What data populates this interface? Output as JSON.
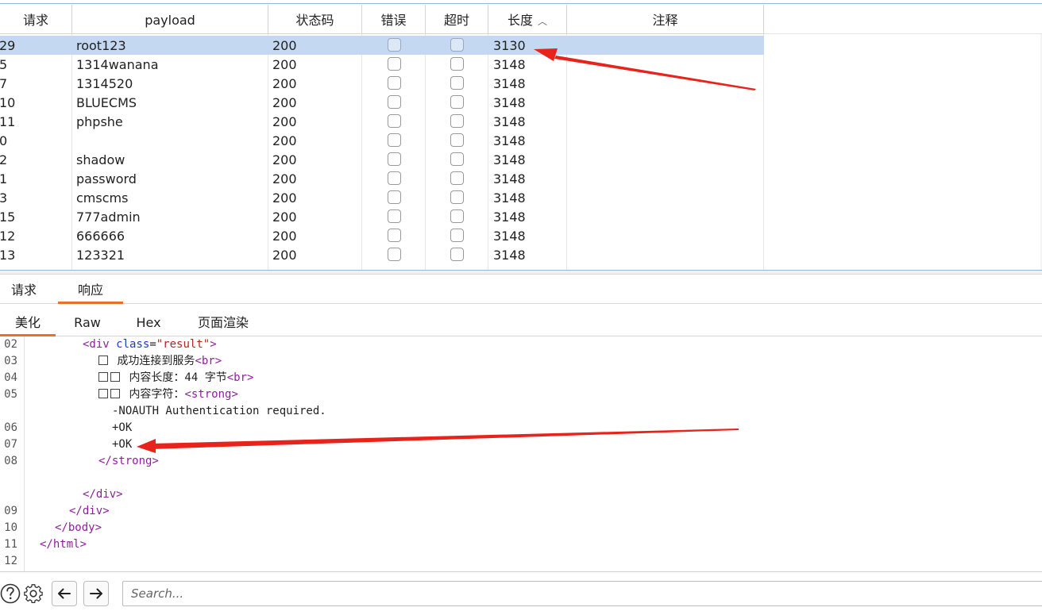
{
  "table": {
    "headers": [
      "请求",
      "payload",
      "状态码",
      "错误",
      "超时",
      "长度",
      "注释"
    ],
    "sort_indicator": "^",
    "rows": [
      {
        "request": "29",
        "payload": "root123",
        "status": "200",
        "length": "3130"
      },
      {
        "request": "5",
        "payload": "1314wanana",
        "status": "200",
        "length": "3148"
      },
      {
        "request": "7",
        "payload": "1314520",
        "status": "200",
        "length": "3148"
      },
      {
        "request": "10",
        "payload": "BLUECMS",
        "status": "200",
        "length": "3148"
      },
      {
        "request": "11",
        "payload": "phpshe",
        "status": "200",
        "length": "3148"
      },
      {
        "request": "0",
        "payload": "",
        "status": "200",
        "length": "3148"
      },
      {
        "request": "2",
        "payload": "shadow",
        "status": "200",
        "length": "3148"
      },
      {
        "request": "1",
        "payload": "password",
        "status": "200",
        "length": "3148"
      },
      {
        "request": "3",
        "payload": "cmscms",
        "status": "200",
        "length": "3148"
      },
      {
        "request": "15",
        "payload": "777admin",
        "status": "200",
        "length": "3148"
      },
      {
        "request": "12",
        "payload": "666666",
        "status": "200",
        "length": "3148"
      },
      {
        "request": "13",
        "payload": "123321",
        "status": "200",
        "length": "3148"
      }
    ]
  },
  "main_tabs": [
    "请求",
    "响应"
  ],
  "sub_tabs": [
    "美化",
    "Raw",
    "Hex",
    "页面渲染"
  ],
  "code": {
    "line_numbers": [
      "02",
      "03",
      "04",
      "05",
      "06",
      "07",
      "08",
      "09",
      "10",
      "11",
      "12"
    ],
    "l02": {
      "open": "<div ",
      "attr": "class",
      "eq": "=",
      "val": "\"result\"",
      "close": ">"
    },
    "l03": {
      "text": "成功连接到服务",
      "tag": "<br>"
    },
    "l04": {
      "text": "内容长度：44 字节",
      "tag": "<br>"
    },
    "l05": {
      "text": "内容字符：",
      "tag": "<strong>"
    },
    "l05b": "-NOAUTH Authentication required.",
    "l06": "+OK",
    "l07": "+OK",
    "l08": "</strong>",
    "l08b": "</div>",
    "l09": "</div>",
    "l10": "</body>",
    "l11": "</html>"
  },
  "toolbar": {
    "search_placeholder": "Search..."
  },
  "colors": {
    "selected_row": "#c5d8f2",
    "active_tab_underline": "#e8702a",
    "arrow": "#e8231b",
    "tag": "#8e1f9c"
  }
}
